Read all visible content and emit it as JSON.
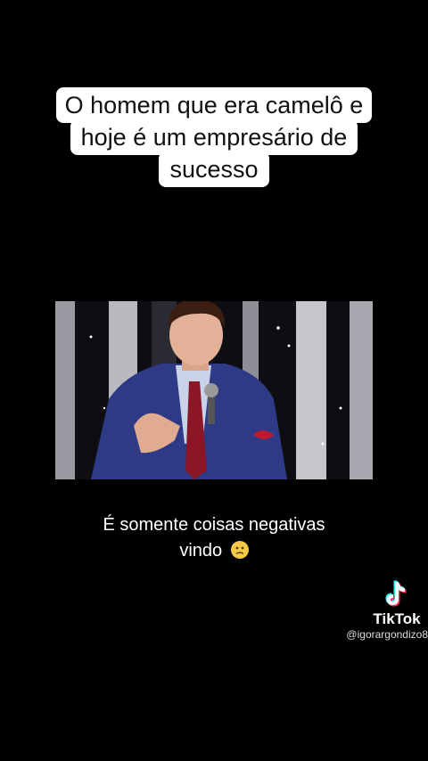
{
  "title": {
    "lines": [
      "O homem que era camelô e",
      "hoje é um empresário de",
      "sucesso"
    ]
  },
  "caption": {
    "line1": "É somente coisas negativas",
    "line2": "vindo",
    "emoji": "slightly-frowning-face"
  },
  "watermark": {
    "brand": "TikTok",
    "handle": "@igorargondizo8",
    "icon": "tiktok-logo-icon"
  },
  "colors": {
    "background": "#000000",
    "title_bg": "#ffffff",
    "title_text": "#111111",
    "tiktok_cyan": "#25F4EE",
    "tiktok_red": "#FE2C55"
  }
}
